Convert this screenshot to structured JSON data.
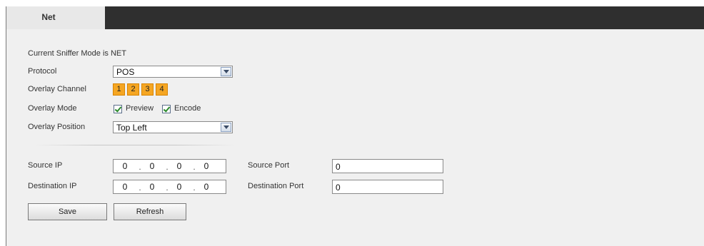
{
  "header": {
    "tab_label": "Net"
  },
  "sniffer": {
    "status_text": "Current Sniffer Mode is NET"
  },
  "protocol": {
    "label": "Protocol",
    "value": "POS"
  },
  "overlay_channel": {
    "label": "Overlay Channel",
    "channels": [
      "1",
      "2",
      "3",
      "4"
    ]
  },
  "overlay_mode": {
    "label": "Overlay Mode",
    "options": [
      {
        "label": "Preview",
        "checked": true
      },
      {
        "label": "Encode",
        "checked": true
      }
    ]
  },
  "overlay_position": {
    "label": "Overlay Position",
    "value": "Top Left"
  },
  "source": {
    "ip_label": "Source IP",
    "ip": [
      "0",
      "0",
      "0",
      "0"
    ],
    "port_label": "Source Port",
    "port": "0"
  },
  "destination": {
    "ip_label": "Destination IP",
    "ip": [
      "0",
      "0",
      "0",
      "0"
    ],
    "port_label": "Destination Port",
    "port": "0"
  },
  "buttons": {
    "save": "Save",
    "refresh": "Refresh"
  },
  "colors": {
    "channel_button": "#f5a623",
    "top_bar": "#2f2f2f",
    "panel": "#f0f0f0"
  }
}
